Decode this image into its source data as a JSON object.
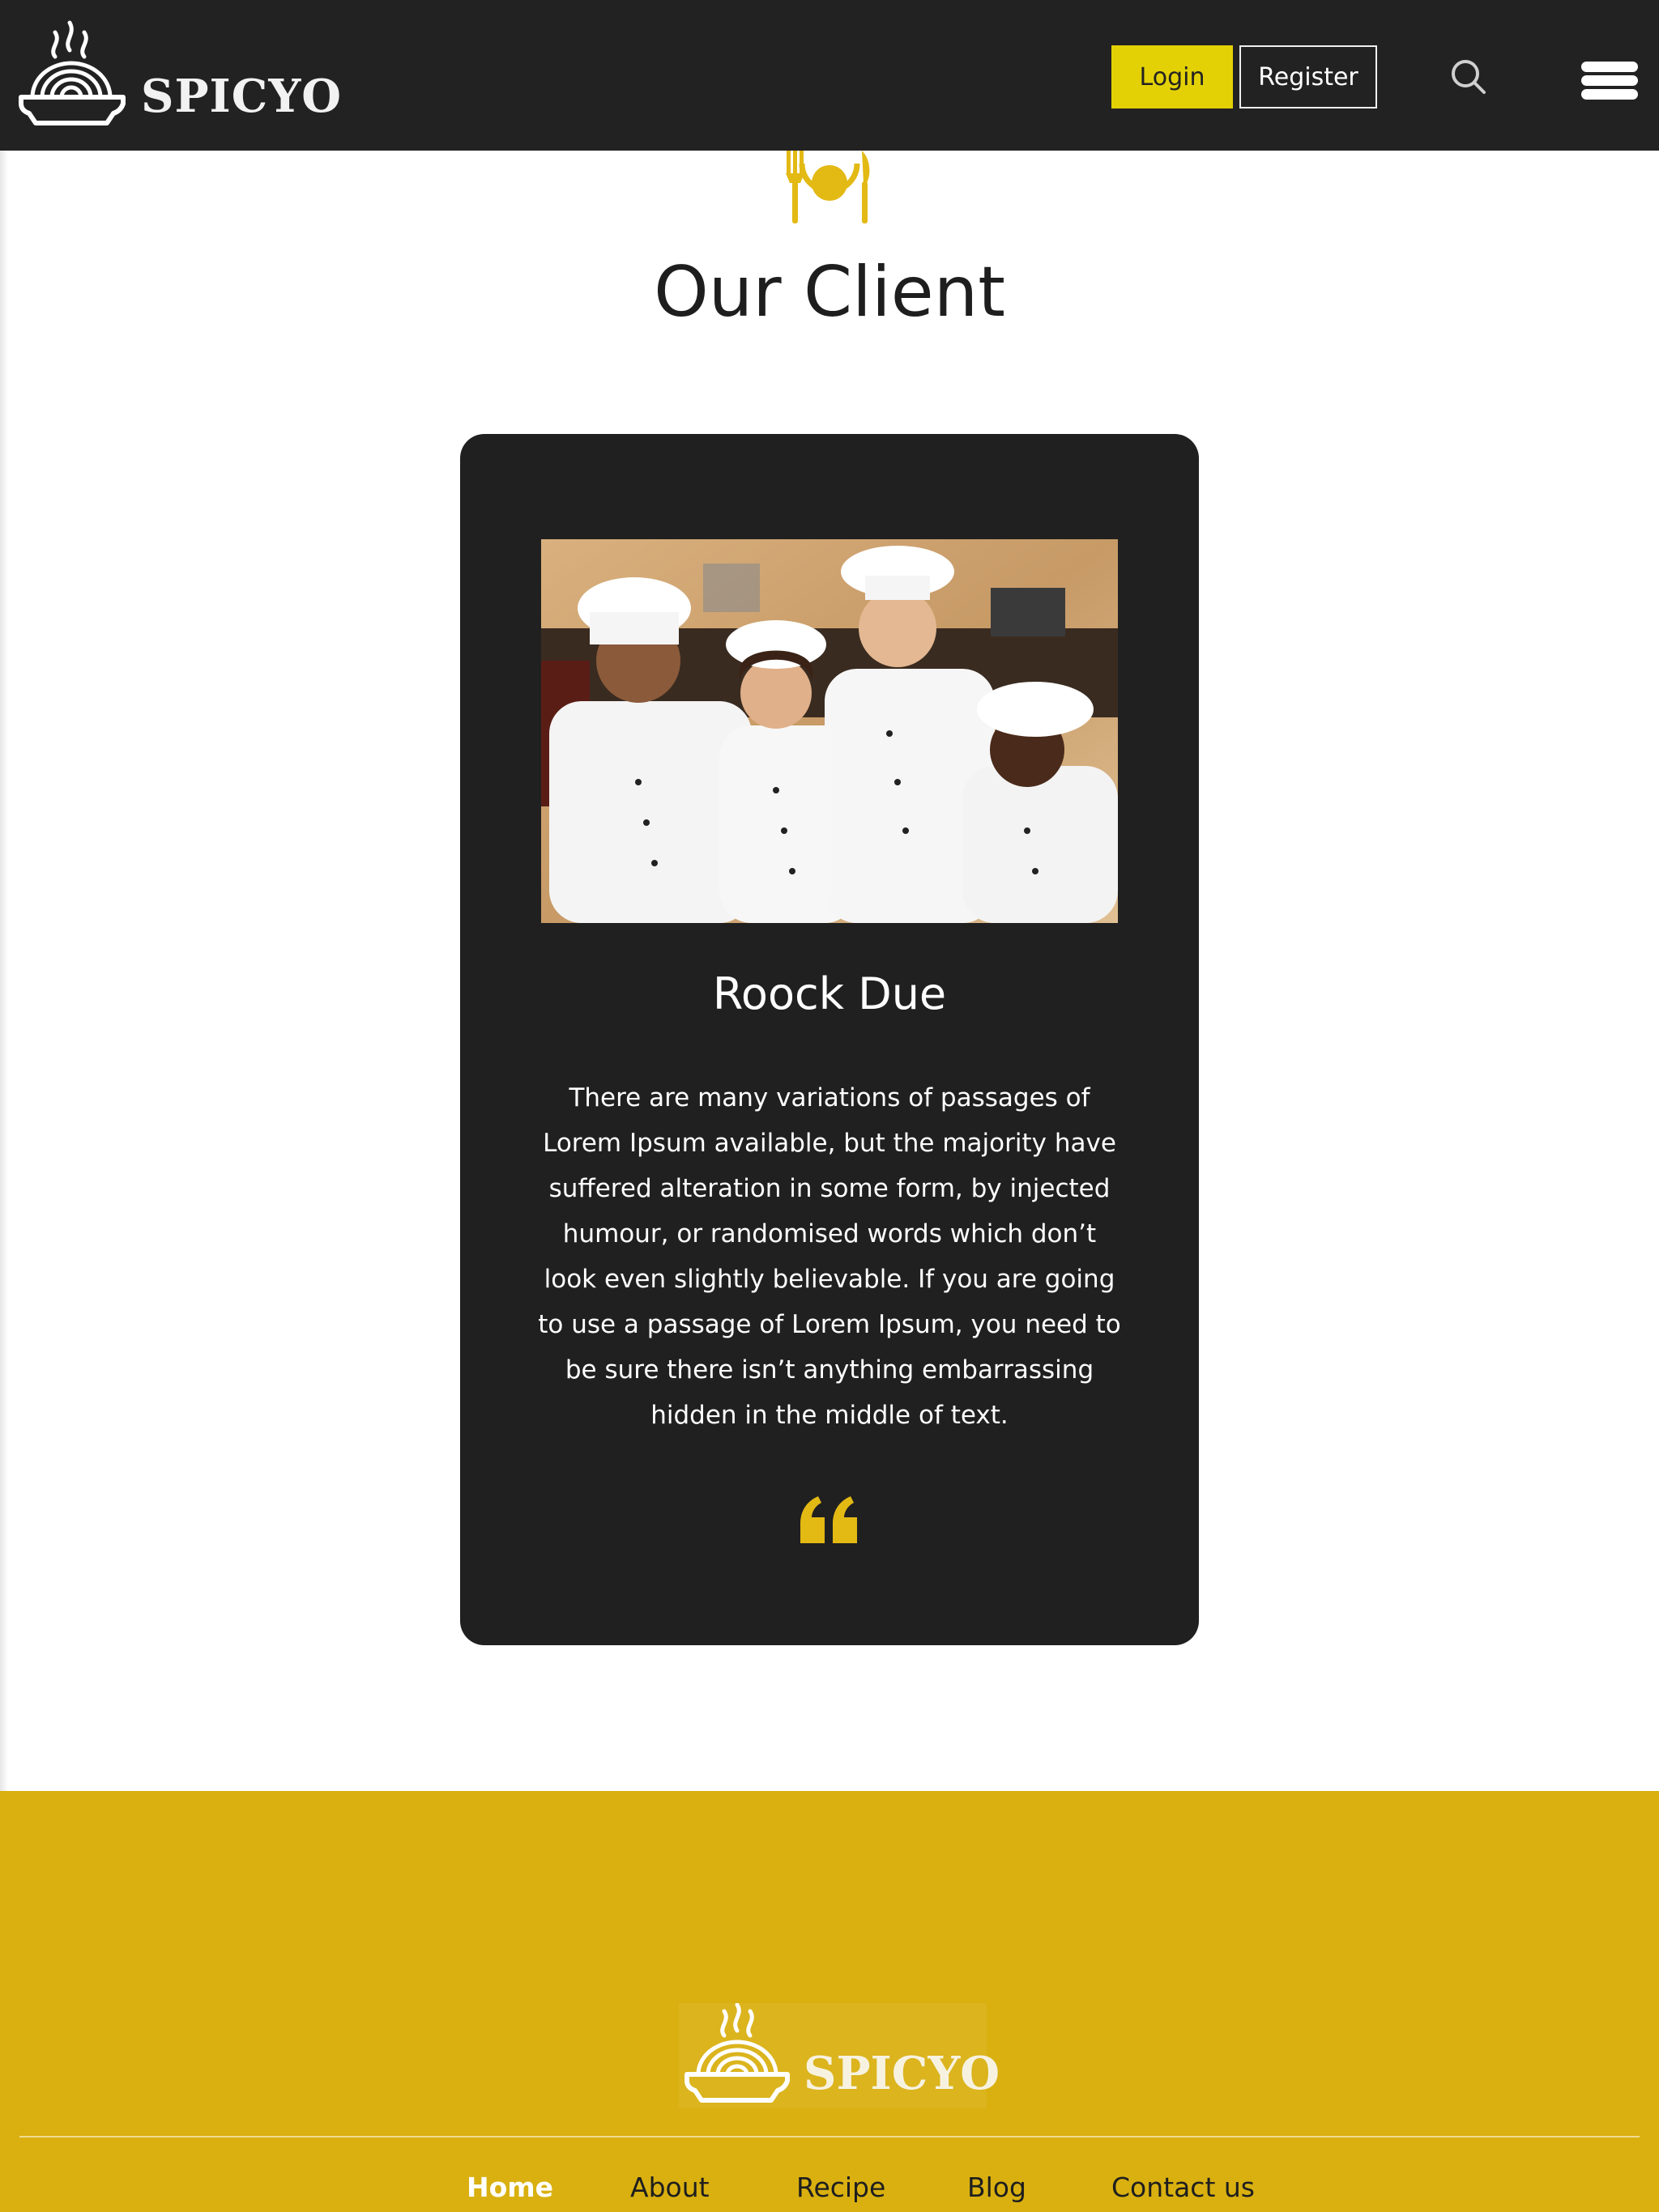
{
  "header": {
    "brand": "SPICYO",
    "login_label": "Login",
    "register_label": "Register",
    "search_icon": "search-icon",
    "menu_icon": "hamburger-menu-icon"
  },
  "client_section": {
    "icon": "plate-cutlery-icon",
    "title": "Our Client",
    "client": {
      "photo": "chefs-group-photo",
      "name": "Roock Due",
      "text": "There are many variations of passages of Lorem Ipsum available, but the majority have suffered alteration in some form, by injected humour, or randomised words which don’t look even slightly believable. If you are going to use a passage of Lorem Ipsum, you need to be sure there isn’t anything embarrassing hidden in the middle of text.",
      "quote_icon": "quote-icon"
    }
  },
  "footer": {
    "brand": "SPICYO",
    "nav": [
      {
        "label": "Home",
        "active": true
      },
      {
        "label": "About",
        "active": false
      },
      {
        "label": "Recipe",
        "active": false
      },
      {
        "label": "Blog",
        "active": false
      },
      {
        "label": "Contact us",
        "active": false
      }
    ]
  },
  "colors": {
    "header_bg": "#222222",
    "accent_yellow": "#e3d106",
    "gold": "#d9b010",
    "card_bg": "#202020"
  }
}
